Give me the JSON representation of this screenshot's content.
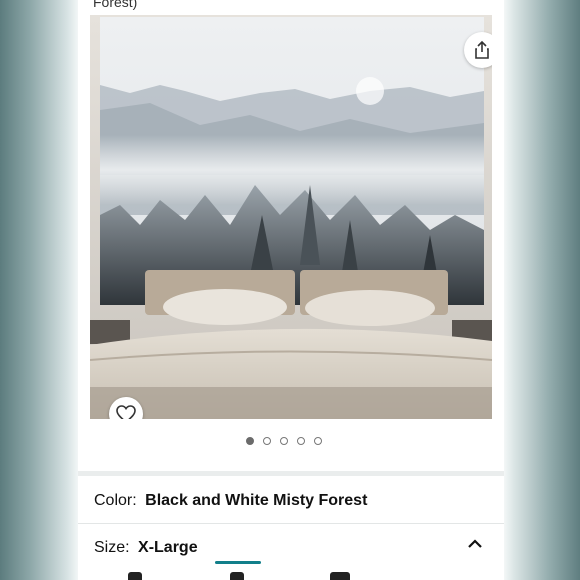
{
  "header": {
    "partial_title": "Forest)"
  },
  "product_image": {
    "description_icon": "bed-with-misty-forest-tapestry",
    "share_icon": "share-icon",
    "favorite_icon": "heart-outline-icon"
  },
  "carousel": {
    "total": 5,
    "active_index": 0
  },
  "variations": {
    "color_label": "Color:",
    "color_value": "Black and White Misty Forest",
    "size_label": "Size:",
    "size_value": "X-Large",
    "size_chevron_icon": "chevron-up-icon"
  },
  "colors": {
    "accent_teal": "#127f8a",
    "dot_active": "#6b6b6b"
  }
}
